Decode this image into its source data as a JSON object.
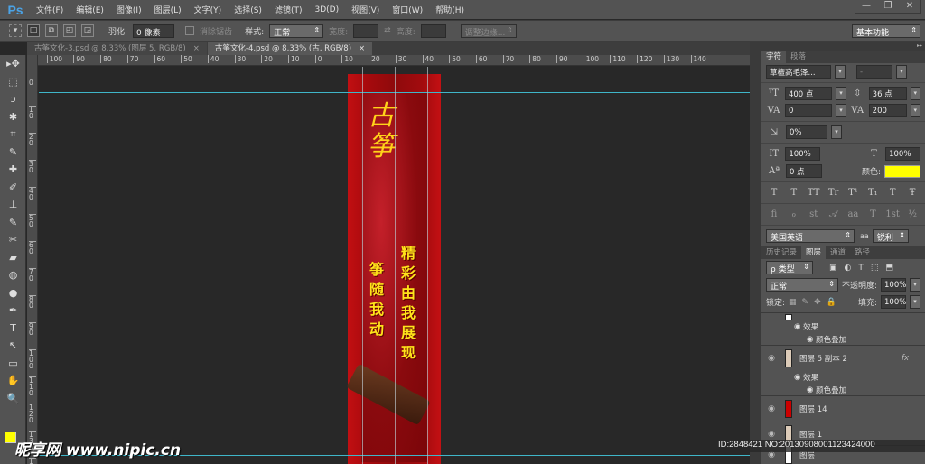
{
  "app": {
    "logo": "Ps",
    "menus": [
      "文件(F)",
      "编辑(E)",
      "图像(I)",
      "图层(L)",
      "文字(Y)",
      "选择(S)",
      "滤镜(T)",
      "3D(D)",
      "视图(V)",
      "窗口(W)",
      "帮助(H)"
    ],
    "window_controls": [
      "—",
      "❐",
      "✕"
    ]
  },
  "options": {
    "feather_label": "羽化:",
    "feather_value": "0 像素",
    "antialias_label": "消除锯齿",
    "style_label": "样式:",
    "style_value": "正常",
    "width_label": "宽度:",
    "height_label": "高度:",
    "refine_edge": "调整边缘...",
    "workspace": "基本功能"
  },
  "tabs": [
    {
      "label": "古筝文化-3.psd @ 8.33% (图层 5, RGB/8)",
      "close": "×"
    },
    {
      "label": "古筝文化-4.psd @ 8.33% (古, RGB/8)",
      "close": "×"
    }
  ],
  "hruler": [
    "110",
    "100",
    "90",
    "80",
    "70",
    "60",
    "50",
    "40",
    "30",
    "20",
    "10",
    "0",
    "10",
    "20",
    "30",
    "40",
    "50",
    "60",
    "70",
    "80",
    "90",
    "100",
    "110",
    "120",
    "130",
    "140"
  ],
  "vruler": [
    "0",
    "1 0",
    "2 0",
    "3 0",
    "4 0",
    "5 0",
    "6 0",
    "7 0",
    "8 0",
    "9 0",
    "1 0 0",
    "1 1 0",
    "1 2 0",
    "1 3 0",
    "1 4"
  ],
  "tools": [
    "▸✥",
    "⬚",
    "ↄ",
    "✱",
    "⌗",
    "✎",
    "✚",
    "✐",
    "⊥",
    "✎",
    "✂",
    "▰",
    "◍",
    "●",
    "✒",
    "T",
    "↖",
    "▭",
    "✋",
    "🔍"
  ],
  "artwork": {
    "title": "古筝",
    "line1": "精彩由我展现",
    "line2": "筝随我动"
  },
  "character_panel": {
    "tabs": [
      "字符",
      "段落"
    ],
    "font": "草檀高毛泽...",
    "font_style": "-",
    "size": "400 点",
    "leading": "36 点",
    "kerning": "0",
    "tracking": "200",
    "tsume": "0%",
    "vscale": "100%",
    "hscale": "100%",
    "baseline": "0 点",
    "color_label": "颜色:",
    "color": "#ffff00",
    "language": "美国英语",
    "aa_label": "aa",
    "antialias": "锐利",
    "styles": [
      "T",
      "T",
      "TT",
      "Tr",
      "T¹",
      "T₁",
      "T",
      "Ŧ"
    ],
    "opentype": [
      "fi",
      "ℴ",
      "st",
      "𝒜",
      "aa",
      "T",
      "1st",
      "½"
    ]
  },
  "layers_panel": {
    "tabs": [
      "历史记录",
      "图层",
      "通道",
      "路径"
    ],
    "filter": "ρ 类型",
    "blend": "正常",
    "opacity_label": "不透明度:",
    "opacity": "100%",
    "lock_label": "锁定:",
    "fill_label": "填充:",
    "fill": "100%",
    "layers": [
      {
        "name": "",
        "effects": "效果",
        "effect": "颜色叠加"
      },
      {
        "name": "图层 5 副本 2",
        "fx": "fx",
        "effects": "效果",
        "effect": "颜色叠加"
      },
      {
        "name": "图层 14"
      },
      {
        "name": "图层 1"
      },
      {
        "name": "图层"
      }
    ]
  },
  "watermark": {
    "site": "昵享网 www.nipic.cn",
    "id": "ID:2848421 NO:20130908001123424000"
  }
}
